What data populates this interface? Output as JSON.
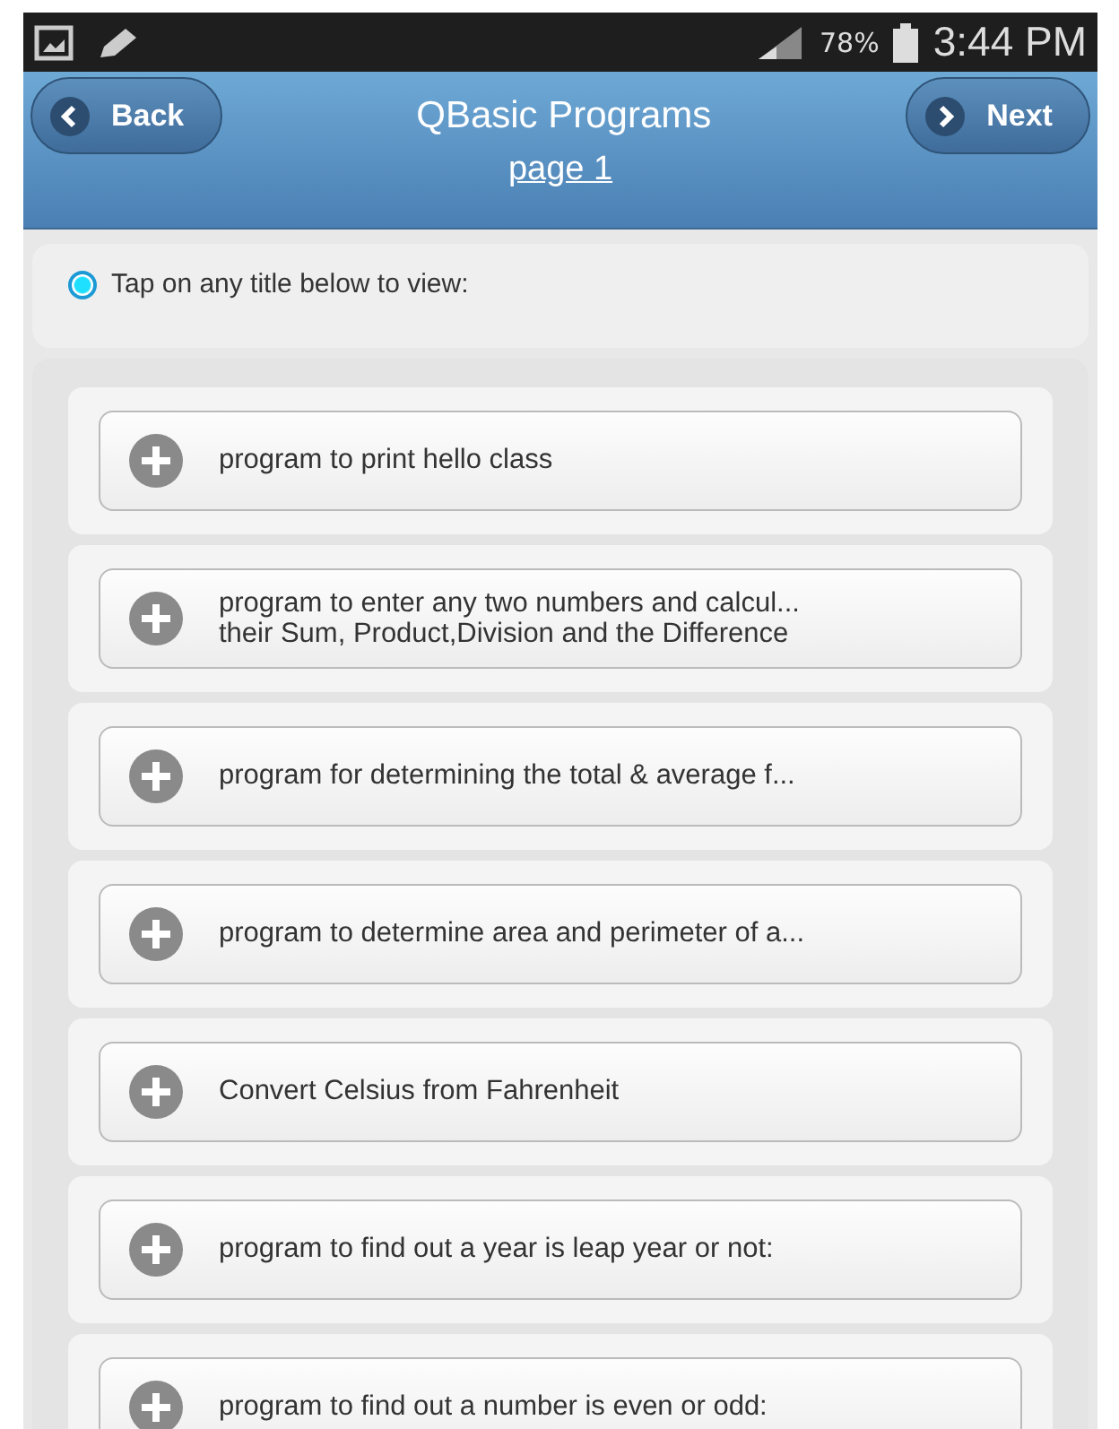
{
  "status_bar": {
    "battery": "78%",
    "time": "3:44 PM"
  },
  "header": {
    "back": "Back",
    "title": "QBasic Programs",
    "next": "Next",
    "page_link": "page 1"
  },
  "hint": {
    "text": "Tap on any title below to view:",
    "selected": true
  },
  "items": [
    {
      "text": "program to print hello class"
    },
    {
      "text": "program to enter any two numbers and calcul...\ntheir Sum, Product,Division and the Difference"
    },
    {
      "text": "program for determining the total & average f..."
    },
    {
      "text": "program to determine area and perimeter of a..."
    },
    {
      "text": "Convert Celsius from Fahrenheit"
    },
    {
      "text": "program to find out a year is leap year or not:"
    },
    {
      "text": "program to find out a number is even or odd:"
    }
  ]
}
